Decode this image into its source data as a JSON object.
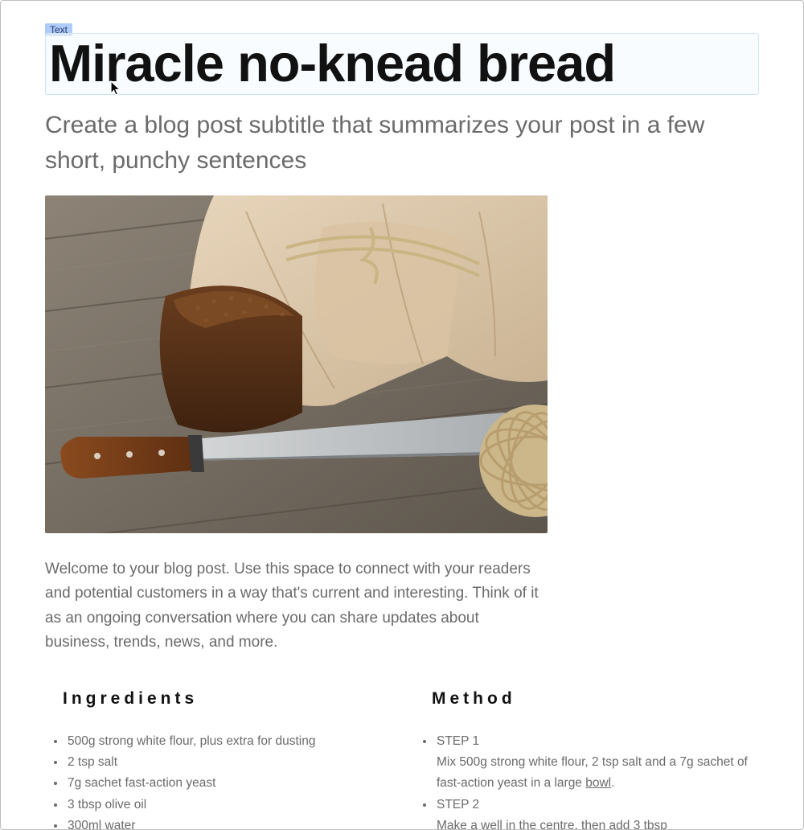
{
  "editor": {
    "selection_badge": "Text"
  },
  "post": {
    "title": "Miracle no-knead bread",
    "subtitle": "Create a blog post subtitle that summarizes your post in a few short, punchy sentences",
    "intro": "Welcome to your blog post. Use this space to connect with your readers and potential customers in a way that's current and interesting. Think of it as an ongoing conversation where you can share updates about business, trends, news, and more."
  },
  "sections": {
    "ingredients": {
      "heading": "Ingredients",
      "items": [
        "500g strong white flour, plus extra for dusting",
        "2 tsp salt",
        "7g sachet fast-action yeast",
        "3 tbsp olive oil",
        "300ml water"
      ]
    },
    "method": {
      "heading": "Method",
      "steps": [
        {
          "label": "STEP 1",
          "body_pre": "Mix 500g strong white flour, 2 tsp salt and a 7g sachet of fast-action yeast in a large ",
          "link": "bowl",
          "body_post": "."
        },
        {
          "label": "STEP 2",
          "body_pre": "Make a well in the centre, then add 3 tbsp",
          "link": "",
          "body_post": ""
        }
      ]
    }
  },
  "image": {
    "alt": "Rustic dark bread loaf in a paper bag with a knife on wooden boards"
  }
}
